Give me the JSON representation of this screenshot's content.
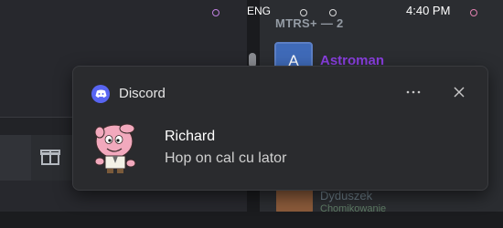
{
  "discord_window": {
    "members_header": "MTRS+ — 2",
    "members": [
      {
        "avatar_letter": "A",
        "name": "Astroman",
        "color": "#8a3fe0"
      },
      {
        "name": "Dyduszek",
        "status": "Chomikowanie"
      }
    ],
    "composer": {
      "gift_icon": "gift-icon"
    }
  },
  "notification": {
    "app_name": "Discord",
    "app_icon": "discord-logo-icon",
    "more_icon": "more-horizontal-icon",
    "close_icon": "close-icon",
    "sender": "Richard",
    "message": "Hop on cal cu lator",
    "accent_color": "#5865f2"
  },
  "taskbar": {
    "language": "ENG",
    "time": "4:40 PM"
  }
}
